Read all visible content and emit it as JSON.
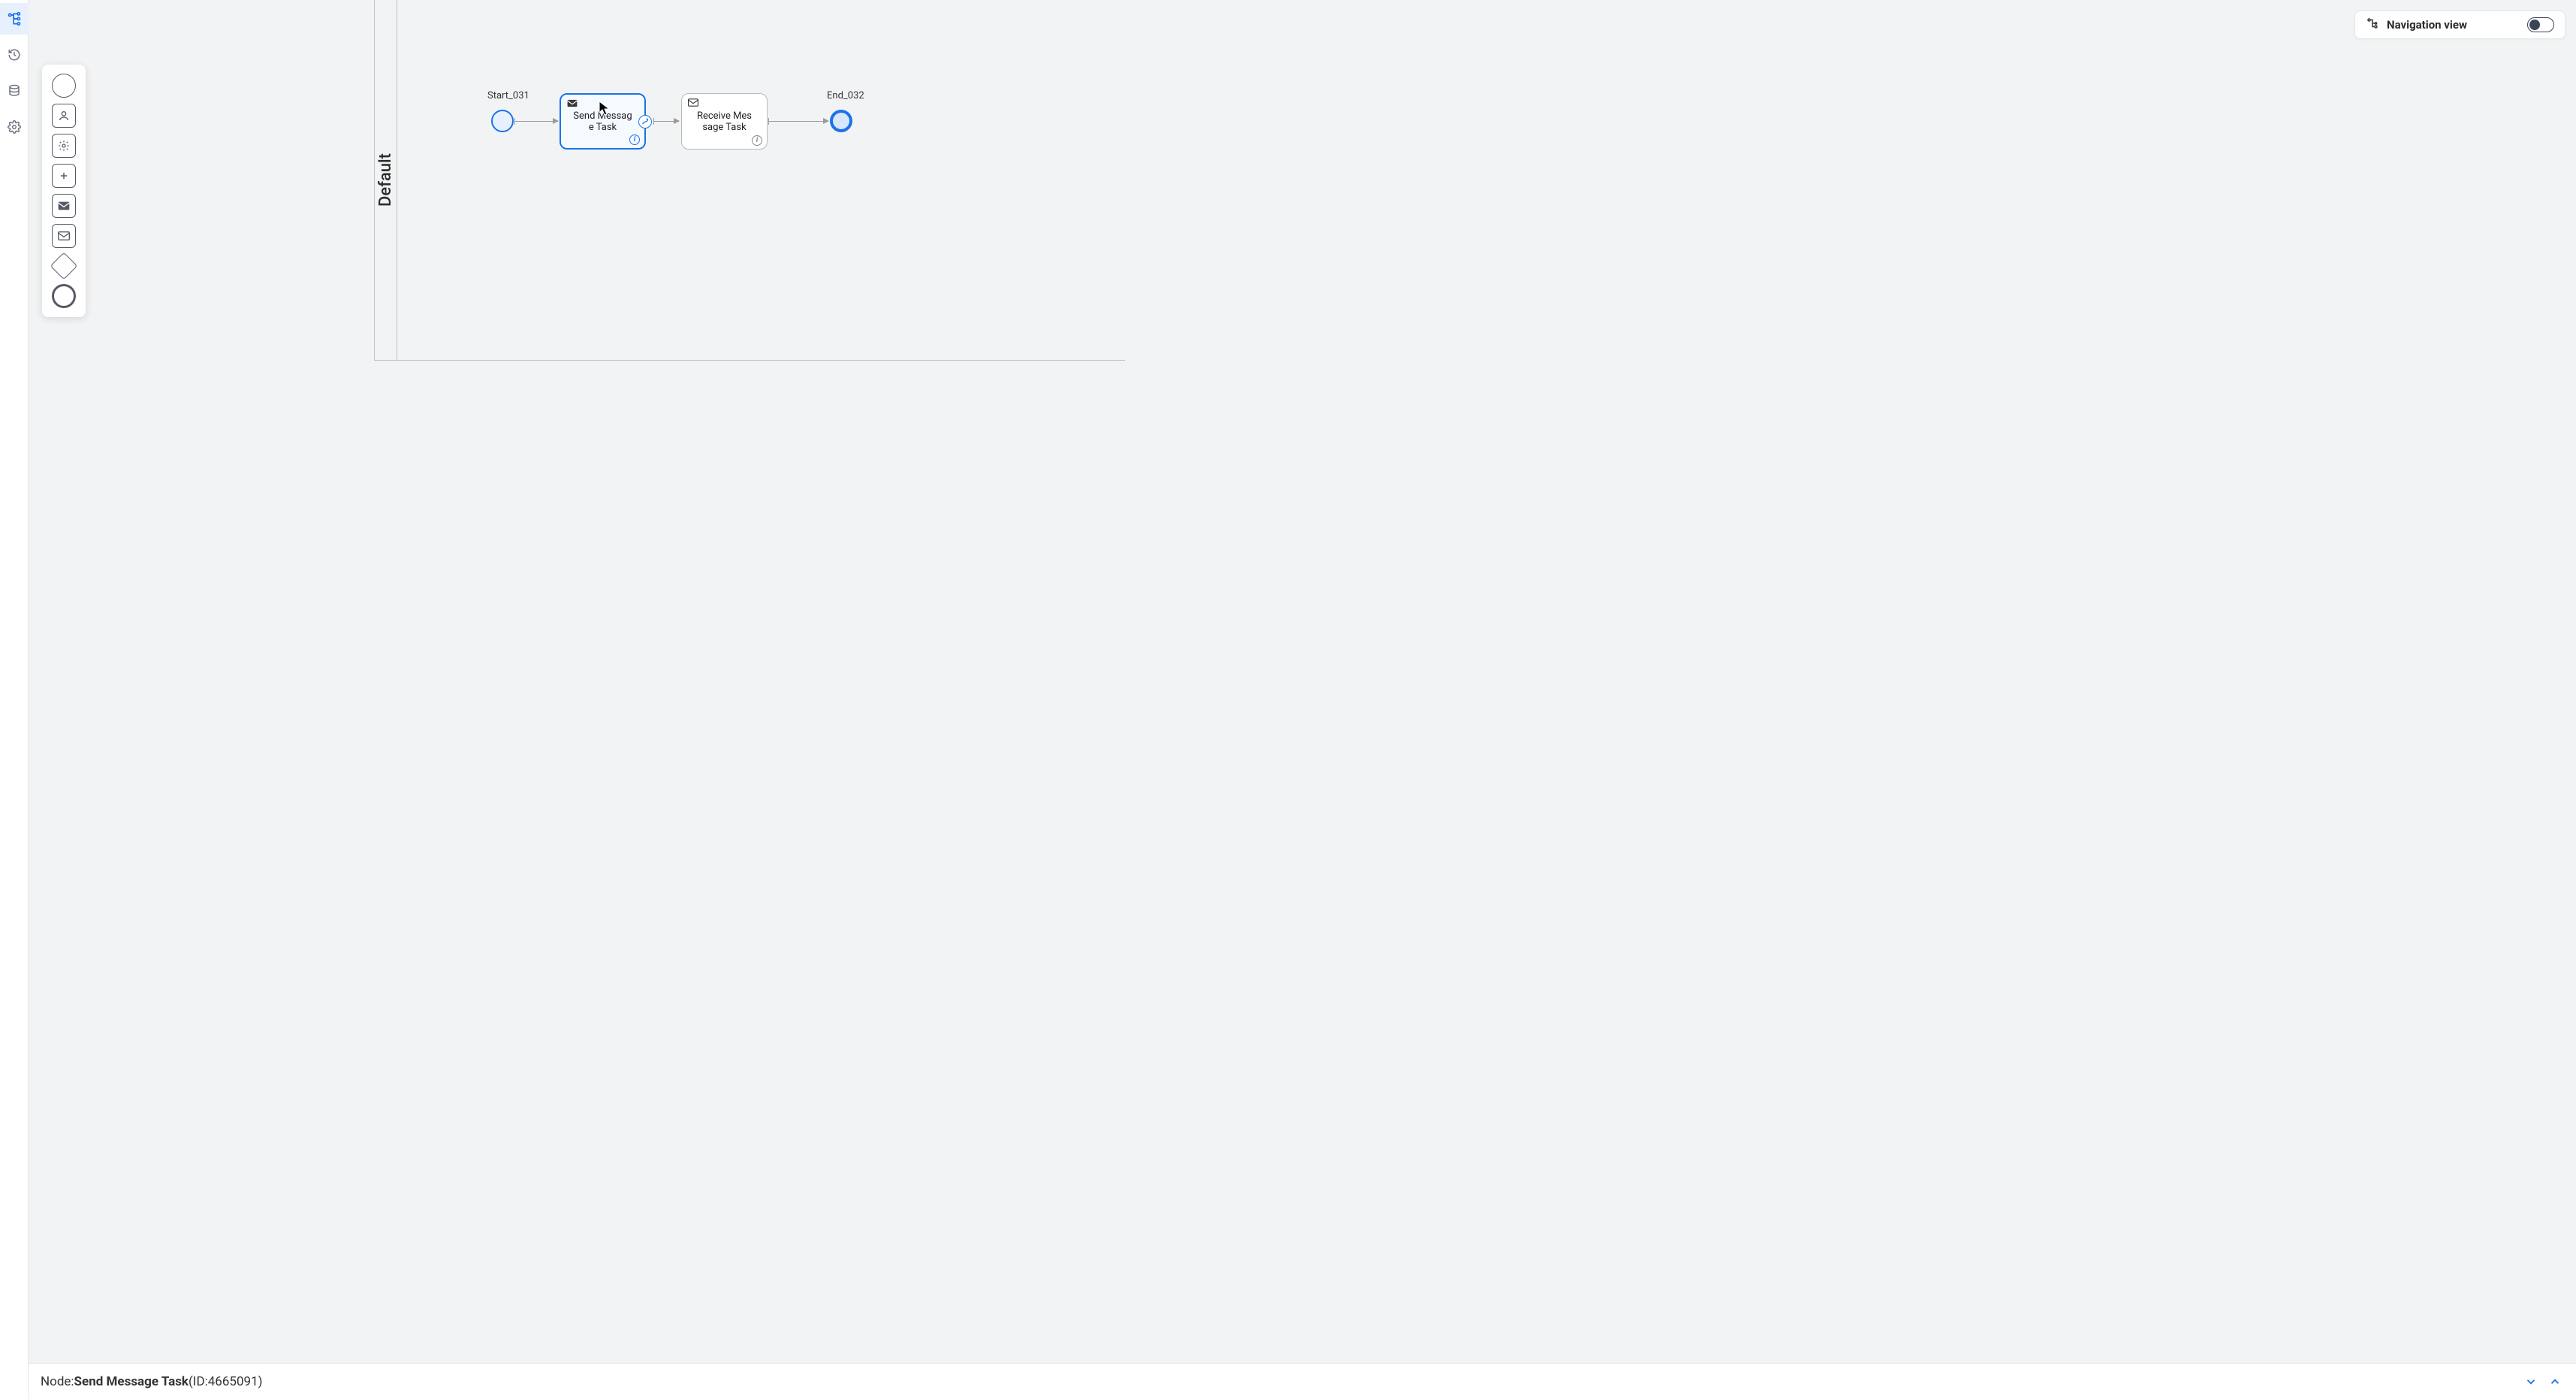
{
  "nav_rail": {
    "buttons": [
      {
        "name": "process-nav-icon",
        "active": true
      },
      {
        "name": "history-icon",
        "active": false
      },
      {
        "name": "database-icon",
        "active": false
      },
      {
        "name": "settings-icon",
        "active": false
      }
    ]
  },
  "palette": {
    "items": [
      {
        "name": "start-event-tool",
        "kind": "circle"
      },
      {
        "name": "user-task-tool",
        "kind": "box",
        "icon": "user"
      },
      {
        "name": "service-task-tool",
        "kind": "box",
        "icon": "gear"
      },
      {
        "name": "generic-task-tool",
        "kind": "box",
        "icon": "plus"
      },
      {
        "name": "send-task-tool",
        "kind": "box",
        "icon": "mail-filled"
      },
      {
        "name": "receive-task-tool",
        "kind": "box",
        "icon": "mail-outline"
      },
      {
        "name": "gateway-tool",
        "kind": "diamond"
      },
      {
        "name": "end-event-tool",
        "kind": "circle-thick"
      }
    ]
  },
  "nav_view": {
    "label": "Navigation view",
    "toggled": false
  },
  "lane": {
    "name": "Default"
  },
  "nodes": {
    "start": {
      "id": "Start_031",
      "label": "Start_031"
    },
    "send": {
      "label_line1": "Send Messag",
      "label_line2": "e Task",
      "selected": true
    },
    "recv": {
      "label_line1": "Receive Mes",
      "label_line2": "sage Task",
      "selected": false
    },
    "end": {
      "id": "End_032",
      "label": "End_032"
    }
  },
  "status": {
    "prefix": "Node: ",
    "name": "Send Message Task",
    "id_prefix": " (ID: ",
    "id": "4665091",
    "id_suffix": ")"
  }
}
